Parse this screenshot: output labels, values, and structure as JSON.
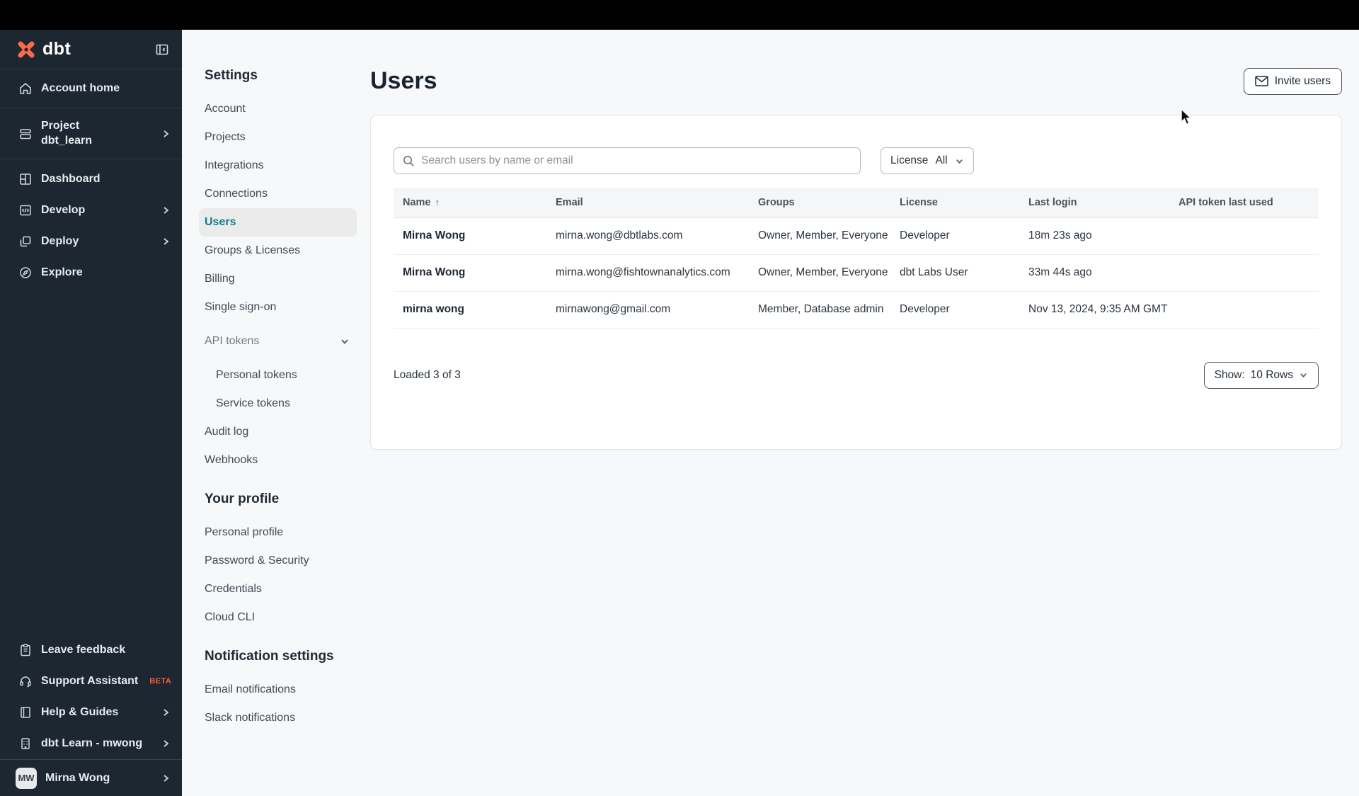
{
  "brand": {
    "name": "dbt"
  },
  "sidebar": {
    "account_home": "Account home",
    "project_label": "Project",
    "project_name": "dbt_learn",
    "dashboard": "Dashboard",
    "develop": "Develop",
    "deploy": "Deploy",
    "explore": "Explore",
    "leave_feedback": "Leave feedback",
    "support_assistant": "Support Assistant",
    "beta_badge": "BETA",
    "help_guides": "Help & Guides",
    "org_account": "dbt Learn - mwong",
    "user_initials": "MW",
    "user_name": "Mirna Wong"
  },
  "settings_nav": {
    "title": "Settings",
    "account": "Account",
    "projects": "Projects",
    "integrations": "Integrations",
    "connections": "Connections",
    "users": "Users",
    "groups_licenses": "Groups & Licenses",
    "billing": "Billing",
    "single_sign_on": "Single sign-on",
    "api_tokens": "API tokens",
    "personal_tokens": "Personal tokens",
    "service_tokens": "Service tokens",
    "audit_log": "Audit log",
    "webhooks": "Webhooks",
    "profile_title": "Your profile",
    "personal_profile": "Personal profile",
    "password_security": "Password & Security",
    "credentials": "Credentials",
    "cloud_cli": "Cloud CLI",
    "notifications_title": "Notification settings",
    "email_notifications": "Email notifications",
    "slack_notifications": "Slack notifications"
  },
  "main": {
    "title": "Users",
    "invite_button": "Invite users",
    "search_placeholder": "Search users by name or email",
    "license_filter": {
      "label": "License",
      "value": "All"
    },
    "table": {
      "headers": {
        "name": "Name",
        "email": "Email",
        "groups": "Groups",
        "license": "License",
        "last_login": "Last login",
        "api_token": "API token last used"
      },
      "sort_indicator": "↑",
      "rows": [
        {
          "name": "Mirna Wong",
          "email": "mirna.wong@dbtlabs.com",
          "groups": "Owner, Member, Everyone",
          "license": "Developer",
          "last_login": "18m 23s ago",
          "api_token": ""
        },
        {
          "name": "Mirna Wong",
          "email": "mirna.wong@fishtownanalytics.com",
          "groups": "Owner, Member, Everyone",
          "license": "dbt Labs User",
          "last_login": "33m 44s ago",
          "api_token": ""
        },
        {
          "name": "mirna wong",
          "email": "mirnawong@gmail.com",
          "groups": "Member, Database admin",
          "license": "Developer",
          "last_login": "Nov 13, 2024, 9:35 AM GMT",
          "api_token": ""
        }
      ]
    },
    "footer": {
      "loaded_text": "Loaded 3 of 3",
      "show_label": "Show:",
      "show_value": "10 Rows"
    }
  },
  "colors": {
    "sidebar_bg": "#1c2732",
    "accent_teal": "#0f7e87",
    "brand_orange": "#ff5c35",
    "logo_orange": "#ff694a"
  }
}
